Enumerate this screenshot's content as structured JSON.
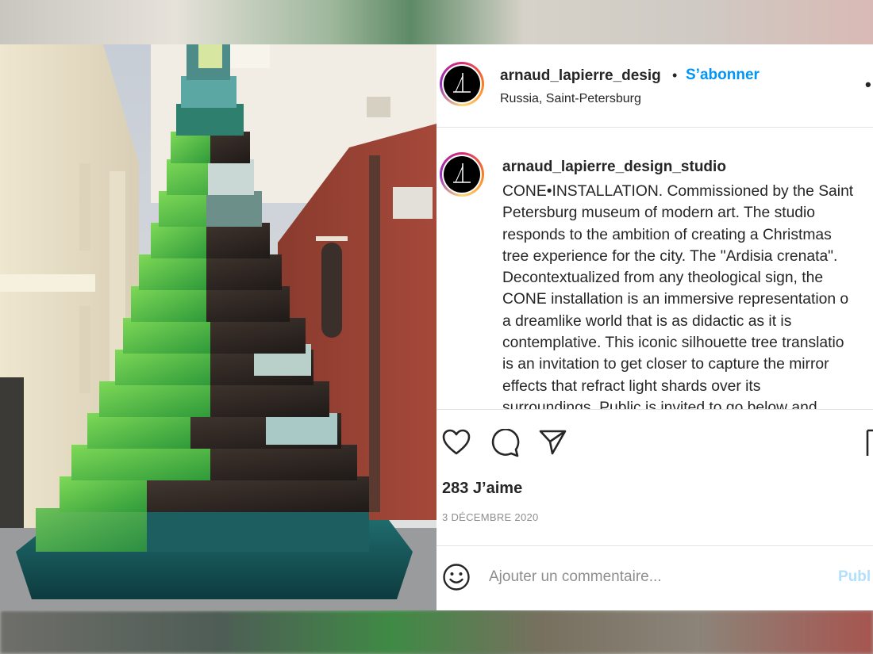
{
  "post": {
    "username": "arnaud_lapierre_desig",
    "separator": "•",
    "follow_label": "S’abonner",
    "location": "Russia, Saint-Petersburg",
    "more_icon": "more-icon"
  },
  "caption": {
    "username": "arnaud_lapierre_design_studio",
    "lines": [
      "CONE•INSTALLATION. Commissioned by the Saint",
      "Petersburg museum of modern art. The studio",
      "responds to the ambition of creating a Christmas",
      "tree experience for the city. The \"Ardisia crenata\".",
      "Decontextualized from any theological sign, the",
      "CONE installation is an immersive representation o",
      "a dreamlike world that is as didactic as it is",
      "contemplative. This iconic silhouette tree translatio",
      "is an invitation to get closer to capture the mirror",
      "effects that refract light shards over its",
      "surroundings. Public is invited to go below and"
    ]
  },
  "actions": {
    "like_icon": "heart-icon",
    "comment_icon": "comment-icon",
    "share_icon": "send-icon",
    "save_icon": "bookmark-icon"
  },
  "stats": {
    "likes": "283 J’aime",
    "date": "3 DÉCEMBRE 2020"
  },
  "comment": {
    "emoji_icon": "emoji-icon",
    "placeholder": "Ajouter un commentaire...",
    "publish_label": "Publ"
  },
  "colors": {
    "link_blue": "#0095f6",
    "publish_disabled": "#b2dffc",
    "text_primary": "#262626",
    "text_secondary": "#8e8e8e"
  }
}
